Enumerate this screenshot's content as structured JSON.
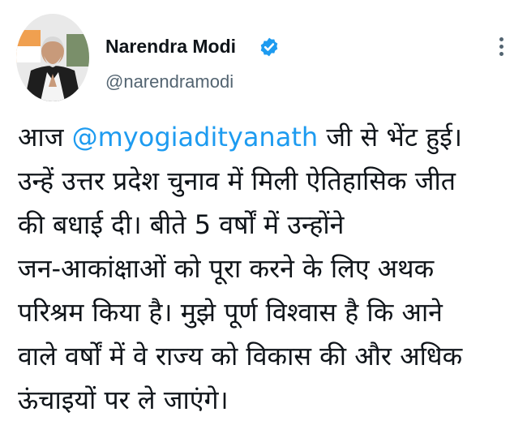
{
  "author": {
    "name": "Narendra Modi",
    "handle": "@narendramodi",
    "verified": true,
    "avatar_icon": "profile-photo"
  },
  "menu_icon": "more-options-icon",
  "colors": {
    "mention": "#1d9bf0",
    "verified_badge": "#1d9bf0",
    "text": "#0f1419",
    "muted": "#536471"
  },
  "tweet": {
    "line1_prefix": "आज ",
    "mention": "@myogiadityanath",
    "line1_suffix": " जी से भेंट हुई।",
    "line2": "उन्हें उत्तर प्रदेश चुनाव में मिली ऐतिहासिक जीत",
    "line3": "की बधाई दी। बीते 5 वर्षों में उन्होंने",
    "line4": "जन-आकांक्षाओं को पूरा करने के लिए अथक",
    "line5": "परिश्रम किया है। मुझे पूर्ण विश्वास है कि आने",
    "line6": "वाले वर्षों में वे राज्य को विकास की और अधिक",
    "line7": "ऊंचाइयों पर ले जाएंगे।"
  }
}
